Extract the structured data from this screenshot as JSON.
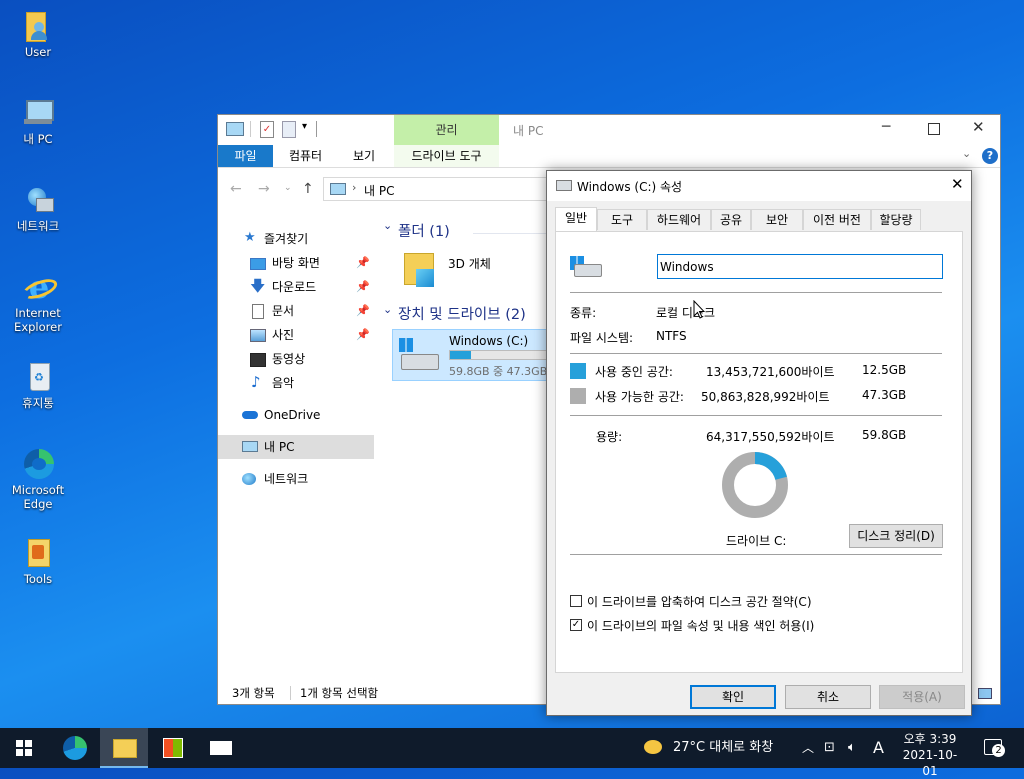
{
  "desktop": {
    "icons": [
      {
        "label": "User",
        "icon": "user-folder-icon"
      },
      {
        "label": "내 PC",
        "icon": "computer-icon"
      },
      {
        "label": "네트워크",
        "icon": "network-icon"
      },
      {
        "label": "Internet\nExplorer",
        "icon": "internet-explorer-icon"
      },
      {
        "label": "휴지통",
        "icon": "recycle-bin-icon"
      },
      {
        "label": "Microsoft\nEdge",
        "icon": "edge-icon"
      },
      {
        "label": "Tools",
        "icon": "tools-icon"
      }
    ]
  },
  "explorer": {
    "title": "내 PC",
    "ribbon_context_label": "관리",
    "tabs": [
      "파일",
      "컴퓨터",
      "보기",
      "드라이브 도구"
    ],
    "address": "내 PC",
    "nav": {
      "quick_access": "즐겨찾기",
      "items": [
        "바탕 화면",
        "다운로드",
        "문서",
        "사진",
        "동영상",
        "음악"
      ],
      "onedrive": "OneDrive",
      "this_pc": "내 PC",
      "network": "네트워크"
    },
    "groups": {
      "folders": "폴더 (1)",
      "drives": "장치 및 드라이브 (2)"
    },
    "folder_3d": "3D 개체",
    "drive": {
      "name": "Windows (C:)",
      "free_text": "59.8GB 중 47.3GB",
      "used_fraction": 0.21
    },
    "status": {
      "items": "3개 항목",
      "selected": "1개 항목 선택함"
    }
  },
  "props": {
    "title": "Windows (C:) 속성",
    "tabs": [
      "일반",
      "도구",
      "하드웨어",
      "공유",
      "보안",
      "이전 버전",
      "할당량"
    ],
    "name_value": "Windows",
    "type_label": "종류:",
    "type_value": "로컬 디스크",
    "fs_label": "파일 시스템:",
    "fs_value": "NTFS",
    "used_label": "사용 중인 공간:",
    "used_bytes": "13,453,721,600바이트",
    "used_gb": "12.5GB",
    "free_label": "사용 가능한 공간:",
    "free_bytes": "50,863,828,992바이트",
    "free_gb": "47.3GB",
    "cap_label": "용량:",
    "cap_bytes": "64,317,550,592바이트",
    "cap_gb": "59.8GB",
    "drive_label": "드라이브 C:",
    "cleanup": "디스크 정리(D)",
    "compress": "이 드라이브를 압축하여 디스크 공간 절약(C)",
    "compress_checked": false,
    "index": "이 드라이브의 파일 속성 및 내용 색인 허용(I)",
    "index_checked": true,
    "ok": "확인",
    "cancel": "취소",
    "apply": "적용(A)",
    "used_fraction": 0.209,
    "used_color": "#26a0da",
    "free_color": "#aeaeae"
  },
  "taskbar": {
    "weather": "27°C  대체로 화창",
    "ime": "A",
    "time": "오후 3:39",
    "date": "2021-10-01",
    "notifications": "2"
  }
}
